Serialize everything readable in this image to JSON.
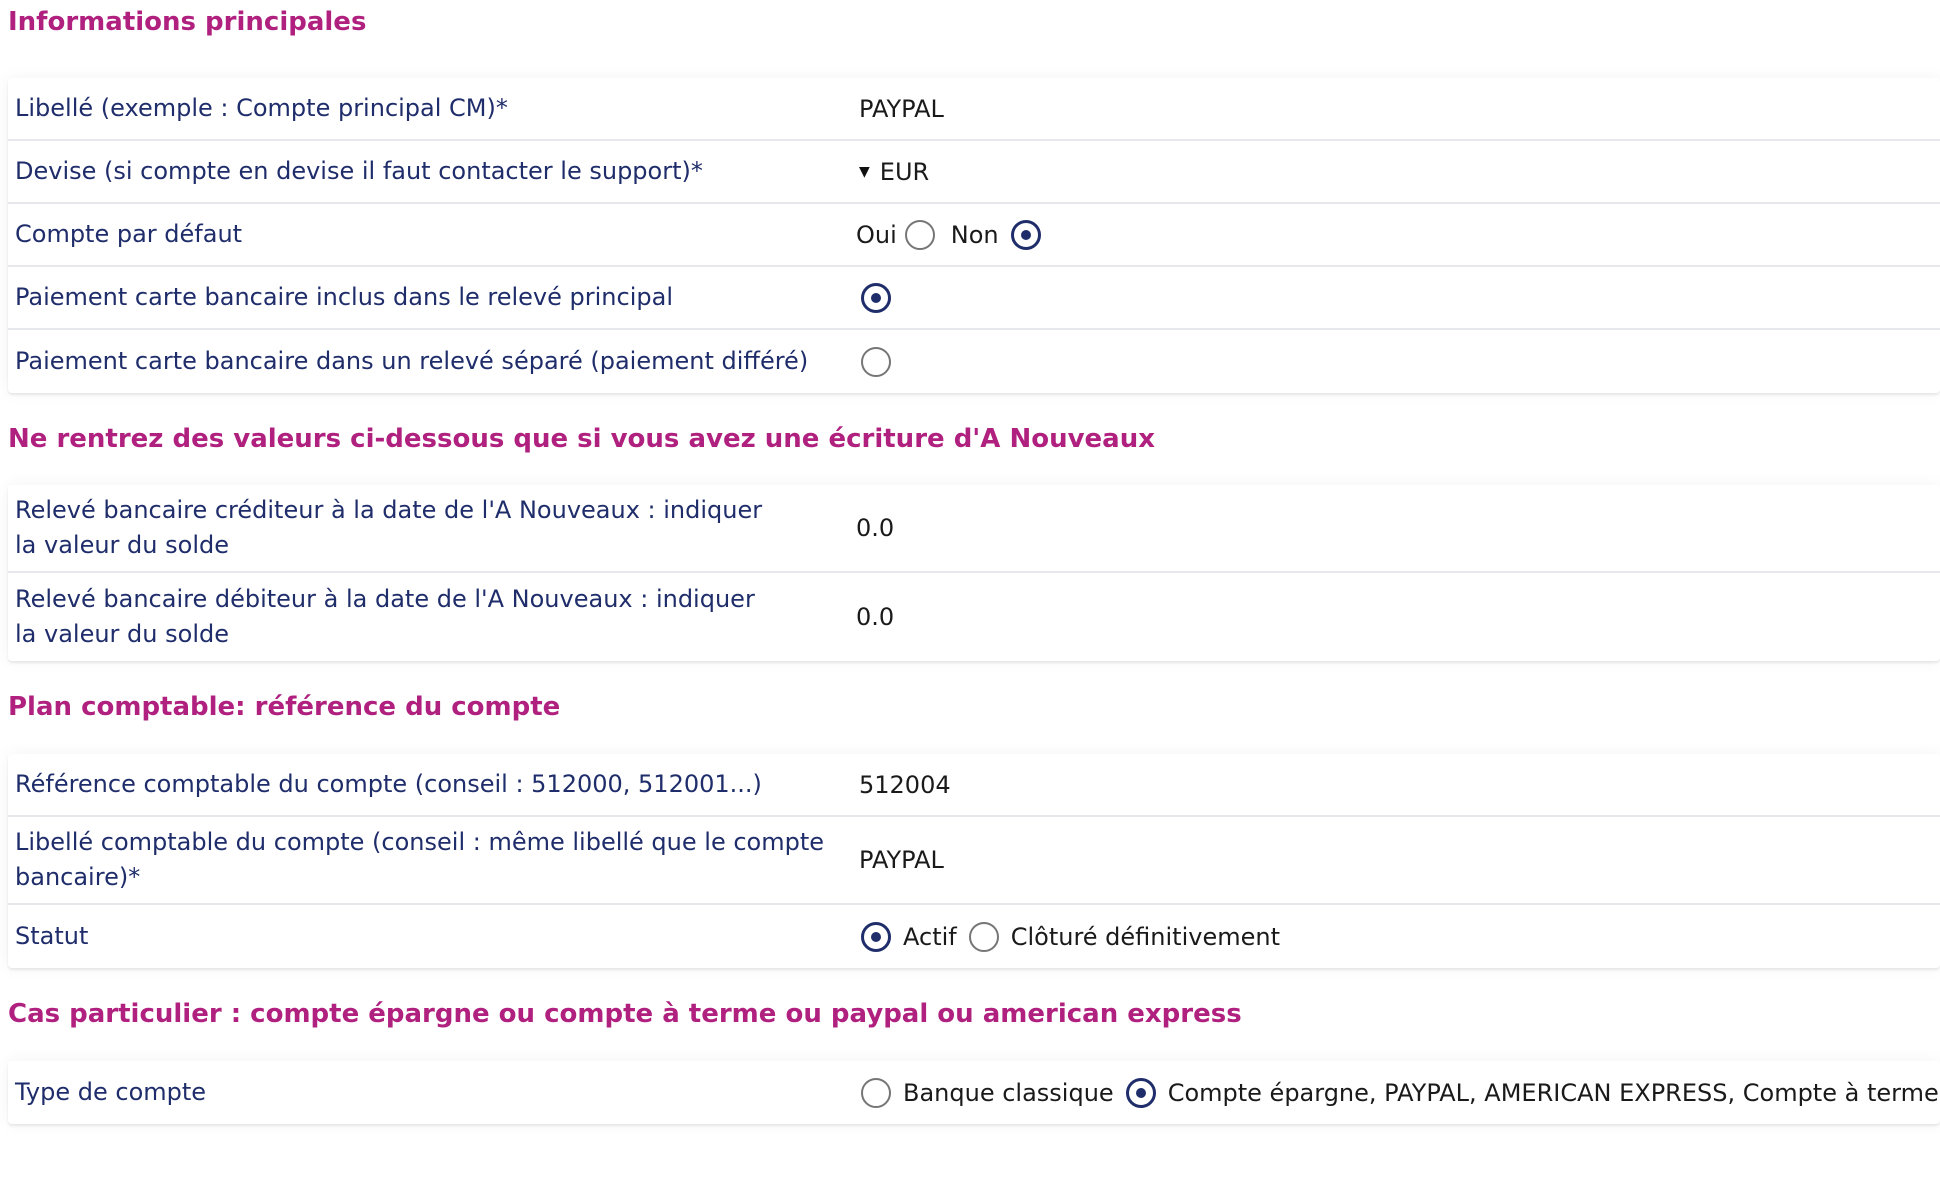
{
  "sections": {
    "main": {
      "title": "Informations principales",
      "libelle": {
        "label": "Libellé (exemple : Compte principal CM)*",
        "value": "PAYPAL"
      },
      "devise": {
        "label": "Devise (si compte en devise il faut contacter le support)*",
        "value": "EUR"
      },
      "compte_defaut": {
        "label": "Compte par défaut",
        "opt_yes": "Oui",
        "opt_no": "Non",
        "selected": "Non"
      },
      "carte_inclus": {
        "label": "Paiement carte bancaire inclus dans le relevé principal",
        "checked": true
      },
      "carte_separe": {
        "label": "Paiement carte bancaire dans un relevé séparé (paiement différé)",
        "checked": false
      }
    },
    "a_nouveaux": {
      "title": "Ne rentrez des valeurs ci-dessous que si vous avez une écriture d'A Nouveaux",
      "crediteur": {
        "label": "Relevé bancaire créditeur à la date de l'A Nouveaux : indiquer la valeur du solde",
        "value": "0.0"
      },
      "debiteur": {
        "label": "Relevé bancaire débiteur à la date de l'A Nouveaux : indiquer la valeur du solde",
        "value": "0.0"
      }
    },
    "plan": {
      "title": "Plan comptable: référence du compte",
      "reference": {
        "label": "Référence comptable du compte (conseil : 512000, 512001...)",
        "value": "512004"
      },
      "libelle_comptable": {
        "label": "Libellé comptable du compte (conseil : même libellé que le compte bancaire)*",
        "value": "PAYPAL"
      },
      "statut": {
        "label": "Statut",
        "opt_actif": "Actif",
        "opt_cloture": "Clôturé définitivement",
        "selected": "Actif"
      }
    },
    "cas": {
      "title": "Cas particulier : compte épargne ou compte à terme ou paypal ou american express",
      "type": {
        "label": "Type de compte",
        "opt_classique": "Banque classique",
        "opt_epargne": "Compte épargne, PAYPAL, AMERICAN EXPRESS, Compte à terme",
        "selected": "Compte épargne, PAYPAL, AMERICAN EXPRESS, Compte à terme"
      }
    }
  },
  "colors": {
    "section_title": "#b0207e",
    "label": "#1f2d6b",
    "radio_selected": "#1f2d6b"
  }
}
